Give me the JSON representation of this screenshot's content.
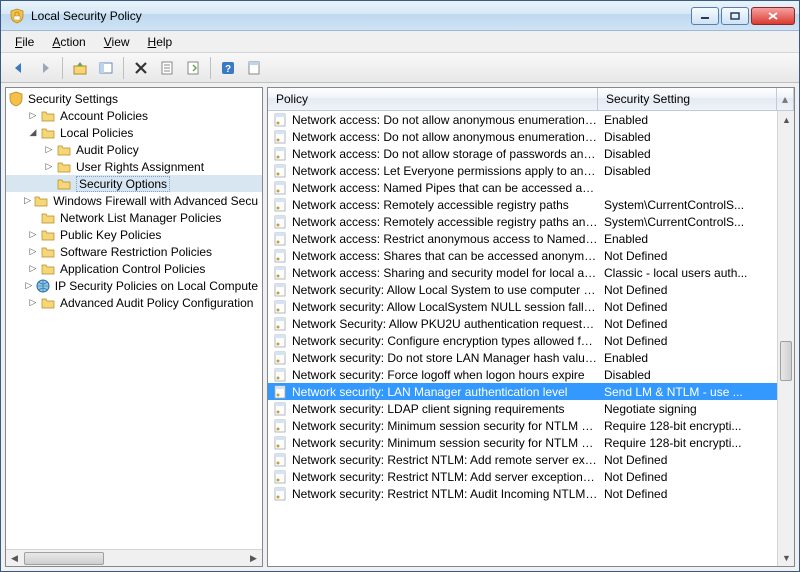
{
  "window": {
    "title": "Local Security Policy"
  },
  "menus": {
    "file": "File",
    "action": "Action",
    "view": "View",
    "help": "Help"
  },
  "tree": {
    "root": "Security Settings",
    "items": [
      {
        "label": "Account Policies",
        "depth": 1,
        "exp": "closed",
        "icon": "folder"
      },
      {
        "label": "Local Policies",
        "depth": 1,
        "exp": "open",
        "icon": "folder"
      },
      {
        "label": "Audit Policy",
        "depth": 2,
        "exp": "closed",
        "icon": "folder"
      },
      {
        "label": "User Rights Assignment",
        "depth": 2,
        "exp": "closed",
        "icon": "folder"
      },
      {
        "label": "Security Options",
        "depth": 2,
        "exp": "none",
        "icon": "folder",
        "selected": true
      },
      {
        "label": "Windows Firewall with Advanced Secu",
        "depth": 1,
        "exp": "closed",
        "icon": "folder"
      },
      {
        "label": "Network List Manager Policies",
        "depth": 1,
        "exp": "none",
        "icon": "folder"
      },
      {
        "label": "Public Key Policies",
        "depth": 1,
        "exp": "closed",
        "icon": "folder"
      },
      {
        "label": "Software Restriction Policies",
        "depth": 1,
        "exp": "closed",
        "icon": "folder"
      },
      {
        "label": "Application Control Policies",
        "depth": 1,
        "exp": "closed",
        "icon": "folder"
      },
      {
        "label": "IP Security Policies on Local Compute",
        "depth": 1,
        "exp": "closed",
        "icon": "globe"
      },
      {
        "label": "Advanced Audit Policy Configuration",
        "depth": 1,
        "exp": "closed",
        "icon": "folder"
      }
    ]
  },
  "list": {
    "headers": {
      "policy": "Policy",
      "setting": "Security Setting"
    },
    "rows": [
      {
        "policy": "Network access: Do not allow anonymous enumeration of S...",
        "setting": "Enabled"
      },
      {
        "policy": "Network access: Do not allow anonymous enumeration of S...",
        "setting": "Disabled"
      },
      {
        "policy": "Network access: Do not allow storage of passwords and cre...",
        "setting": "Disabled"
      },
      {
        "policy": "Network access: Let Everyone permissions apply to anonym...",
        "setting": "Disabled"
      },
      {
        "policy": "Network access: Named Pipes that can be accessed anonym...",
        "setting": ""
      },
      {
        "policy": "Network access: Remotely accessible registry paths",
        "setting": "System\\CurrentControlS..."
      },
      {
        "policy": "Network access: Remotely accessible registry paths and sub...",
        "setting": "System\\CurrentControlS..."
      },
      {
        "policy": "Network access: Restrict anonymous access to Named Pipes...",
        "setting": "Enabled"
      },
      {
        "policy": "Network access: Shares that can be accessed anonymously",
        "setting": "Not Defined"
      },
      {
        "policy": "Network access: Sharing and security model for local accou...",
        "setting": "Classic - local users auth..."
      },
      {
        "policy": "Network security: Allow Local System to use computer ident...",
        "setting": "Not Defined"
      },
      {
        "policy": "Network security: Allow LocalSystem NULL session fallback",
        "setting": "Not Defined"
      },
      {
        "policy": "Network Security: Allow PKU2U authentication requests to t...",
        "setting": "Not Defined"
      },
      {
        "policy": "Network security: Configure encryption types allowed for Ke...",
        "setting": "Not Defined"
      },
      {
        "policy": "Network security: Do not store LAN Manager hash value on ...",
        "setting": "Enabled"
      },
      {
        "policy": "Network security: Force logoff when logon hours expire",
        "setting": "Disabled"
      },
      {
        "policy": "Network security: LAN Manager authentication level",
        "setting": "Send LM & NTLM - use ...",
        "selected": true
      },
      {
        "policy": "Network security: LDAP client signing requirements",
        "setting": "Negotiate signing"
      },
      {
        "policy": "Network security: Minimum session security for NTLM SSP ...",
        "setting": "Require 128-bit encrypti..."
      },
      {
        "policy": "Network security: Minimum session security for NTLM SSP ...",
        "setting": "Require 128-bit encrypti..."
      },
      {
        "policy": "Network security: Restrict NTLM: Add remote server excepti...",
        "setting": "Not Defined"
      },
      {
        "policy": "Network security: Restrict NTLM: Add server exceptions in t...",
        "setting": "Not Defined"
      },
      {
        "policy": "Network security: Restrict NTLM: Audit Incoming NTLM Tra...",
        "setting": "Not Defined"
      }
    ]
  }
}
